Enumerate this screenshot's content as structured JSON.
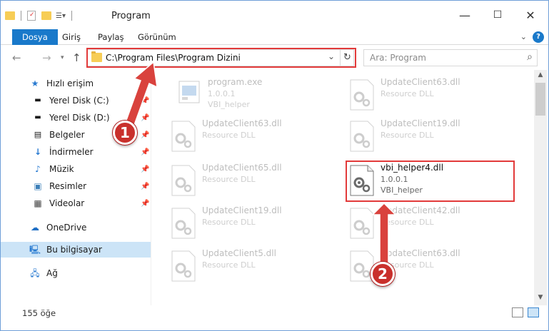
{
  "window": {
    "title": "Program",
    "controls": {
      "minimize": "—",
      "maximize": "☐",
      "close": "✕"
    }
  },
  "ribbon": {
    "tabs": [
      "Dosya",
      "Giriş",
      "Paylaş",
      "Görünüm"
    ]
  },
  "nav": {
    "address_path": "C:\\Program Files\\Program Dizini",
    "search_placeholder": "Ara: Program"
  },
  "sidebar": {
    "items": [
      {
        "label": "Hızlı erişim",
        "icon": "star-icon"
      },
      {
        "label": "Yerel Disk (C:)",
        "icon": "drive-icon",
        "pinned": true
      },
      {
        "label": "Yerel Disk (D:)",
        "icon": "drive-icon",
        "pinned": true
      },
      {
        "label": "Belgeler",
        "icon": "documents-icon",
        "pinned": true
      },
      {
        "label": "İndirmeler",
        "icon": "download-icon",
        "pinned": true
      },
      {
        "label": "Müzik",
        "icon": "music-icon",
        "pinned": true
      },
      {
        "label": "Resimler",
        "icon": "pictures-icon",
        "pinned": true
      },
      {
        "label": "Videolar",
        "icon": "videos-icon",
        "pinned": true
      },
      {
        "label": "OneDrive",
        "icon": "cloud-icon"
      },
      {
        "label": "Bu bilgisayar",
        "icon": "computer-icon",
        "selected": true
      },
      {
        "label": "Ağ",
        "icon": "network-icon"
      }
    ]
  },
  "files": [
    {
      "name": "program.exe",
      "line1": "1.0.0.1",
      "line2": "VBI_helper",
      "type": "exe"
    },
    {
      "name": "UpdateClient63.dll",
      "line1": "Resource DLL",
      "line2": "",
      "type": "dll"
    },
    {
      "name": "UpdateClient63.dll",
      "line1": "Resource DLL",
      "line2": "",
      "type": "dll"
    },
    {
      "name": "UpdateClient19.dll",
      "line1": "Resource DLL",
      "line2": "",
      "type": "dll"
    },
    {
      "name": "UpdateClient65.dll",
      "line1": "Resource DLL",
      "line2": "",
      "type": "dll"
    },
    {
      "name": "vbi_helper4.dll",
      "line1": "1.0.0.1",
      "line2": "VBI_helper",
      "type": "dll",
      "highlighted": true
    },
    {
      "name": "UpdateClient19.dll",
      "line1": "Resource DLL",
      "line2": "",
      "type": "dll"
    },
    {
      "name": "UpdateClient42.dll",
      "line1": "Resource DLL",
      "line2": "",
      "type": "dll"
    },
    {
      "name": "UpdateClient5.dll",
      "line1": "Resource DLL",
      "line2": "",
      "type": "dll"
    },
    {
      "name": "UpdateClient63.dll",
      "line1": "Resource DLL",
      "line2": "",
      "type": "dll"
    }
  ],
  "status": {
    "item_count": "155 öğe"
  },
  "callouts": [
    "1",
    "2"
  ],
  "colors": {
    "accent": "#1979ca",
    "highlight": "#e23a3a",
    "callout": "#c9302c"
  }
}
